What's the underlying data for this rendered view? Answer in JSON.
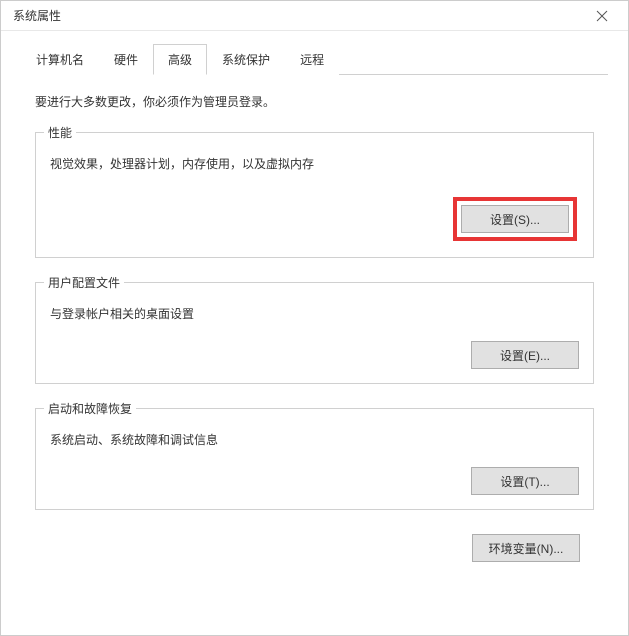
{
  "window": {
    "title": "系统属性"
  },
  "tabs": {
    "items": [
      {
        "label": "计算机名"
      },
      {
        "label": "硬件"
      },
      {
        "label": "高级"
      },
      {
        "label": "系统保护"
      },
      {
        "label": "远程"
      }
    ],
    "active_index": 2
  },
  "body": {
    "info": "要进行大多数更改，你必须作为管理员登录。",
    "performance": {
      "title": "性能",
      "desc": "视觉效果，处理器计划，内存使用，以及虚拟内存",
      "button": "设置(S)..."
    },
    "user_profile": {
      "title": "用户配置文件",
      "desc": "与登录帐户相关的桌面设置",
      "button": "设置(E)..."
    },
    "startup": {
      "title": "启动和故障恢复",
      "desc": "系统启动、系统故障和调试信息",
      "button": "设置(T)..."
    },
    "env_button": "环境变量(N)..."
  }
}
